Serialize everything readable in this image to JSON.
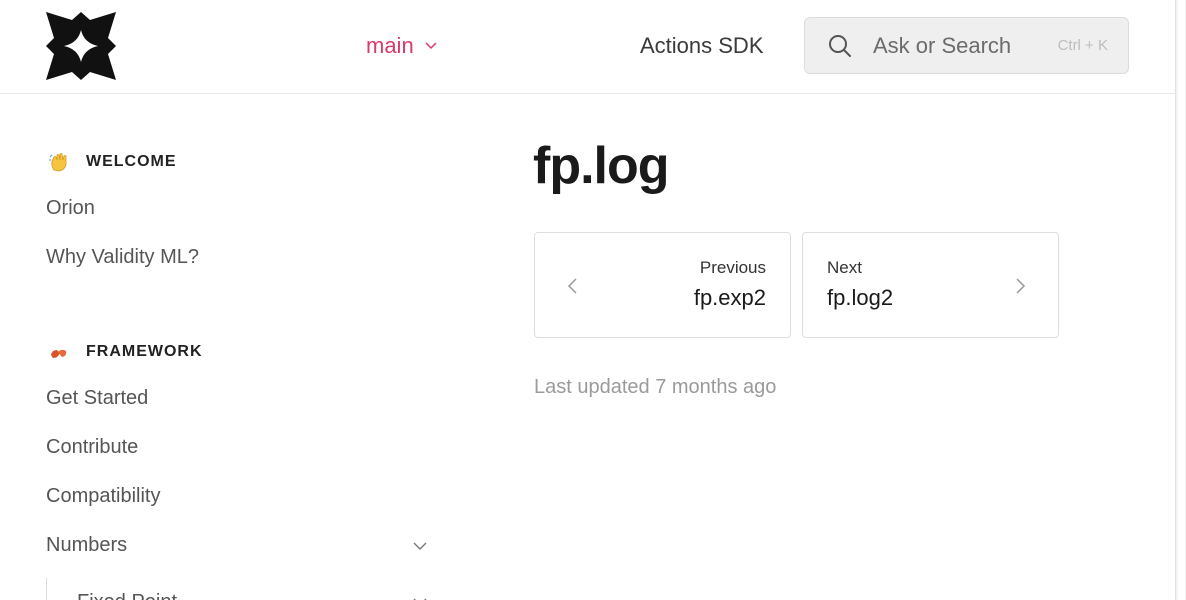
{
  "header": {
    "logo_icon": "four-point-star-logo-icon",
    "version_label": "main",
    "nav_link": "Actions SDK",
    "search": {
      "placeholder": "Ask or Search",
      "shortcut": "Ctrl + K"
    }
  },
  "sidebar": {
    "sections": [
      {
        "emoji": "waving-hand-icon",
        "label": "WELCOME",
        "items": [
          "Orion",
          "Why Validity ML?"
        ]
      },
      {
        "emoji": "red-shapes-icon",
        "label": "FRAMEWORK",
        "items": [
          "Get Started",
          "Contribute",
          "Compatibility",
          "Numbers"
        ],
        "sub_items": [
          "Fixed Point"
        ]
      }
    ]
  },
  "main": {
    "title": "fp.log",
    "pager": {
      "prev_small": "Previous",
      "prev_big": "fp.exp2",
      "next_small": "Next",
      "next_big": "fp.log2"
    },
    "updated_text": "Last updated 7 months ago"
  },
  "colors": {
    "accent": "#d93a6a",
    "text": "#1a1a1a",
    "muted": "#9a9a9a"
  }
}
